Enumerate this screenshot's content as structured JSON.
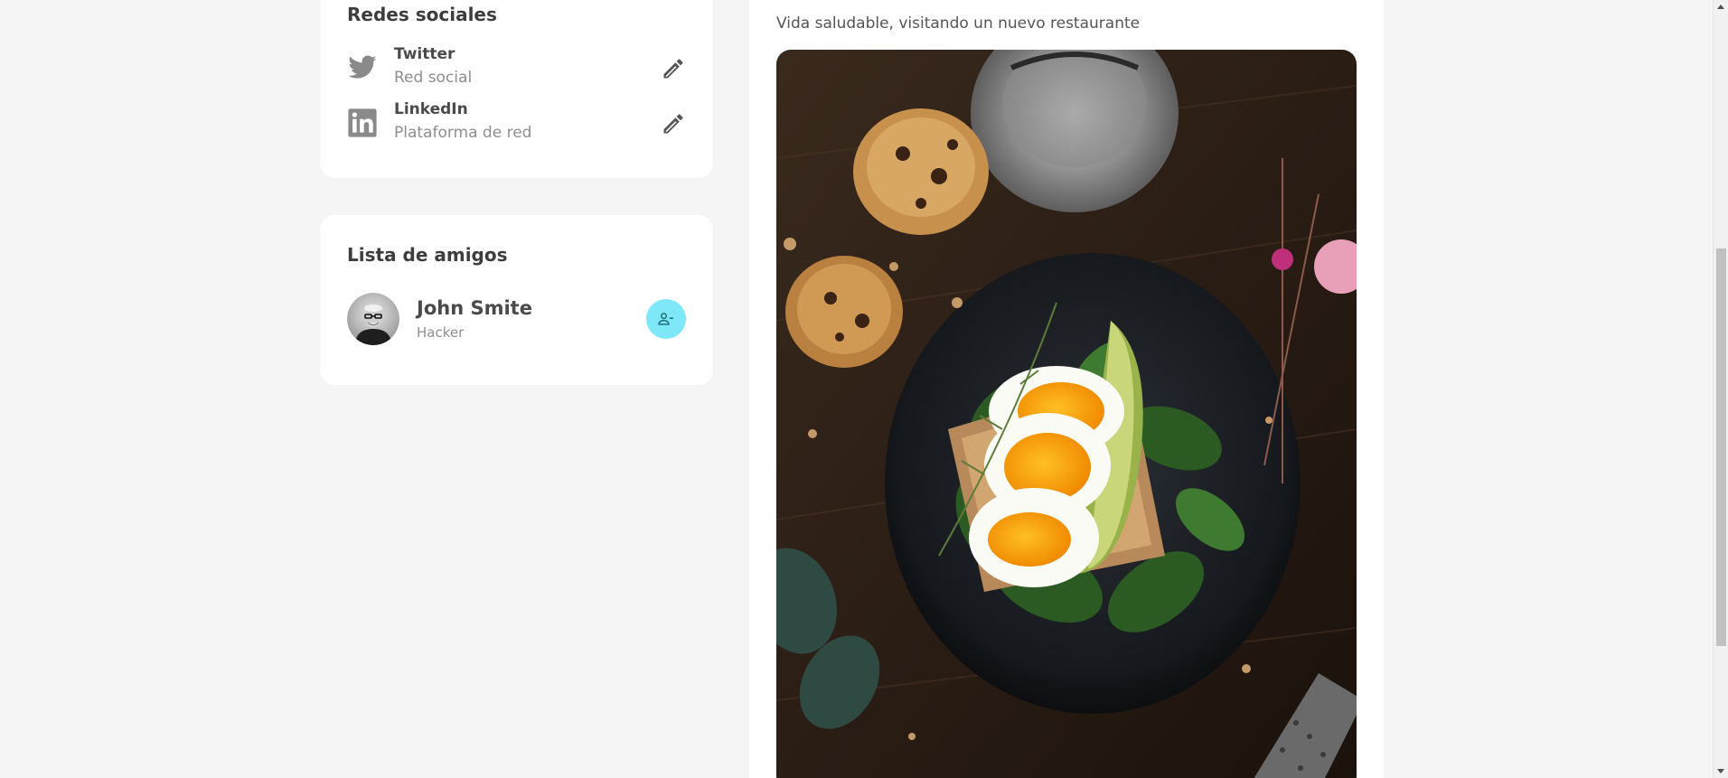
{
  "social": {
    "title": "Redes sociales",
    "items": [
      {
        "name": "Twitter",
        "desc": "Red social",
        "icon": "twitter-icon"
      },
      {
        "name": "LinkedIn",
        "desc": "Plataforma de red",
        "icon": "linkedin-icon"
      }
    ]
  },
  "friends": {
    "title": "Lista de amigos",
    "items": [
      {
        "name": "John Smite",
        "role": "Hacker"
      }
    ]
  },
  "post": {
    "caption": "Vida saludable, visitando un nuevo restaurante"
  },
  "colors": {
    "page_bg": "#f5f5f5",
    "card_bg": "#ffffff",
    "accent": "#7ee8f8",
    "icon_gray": "#7a7a7a"
  }
}
